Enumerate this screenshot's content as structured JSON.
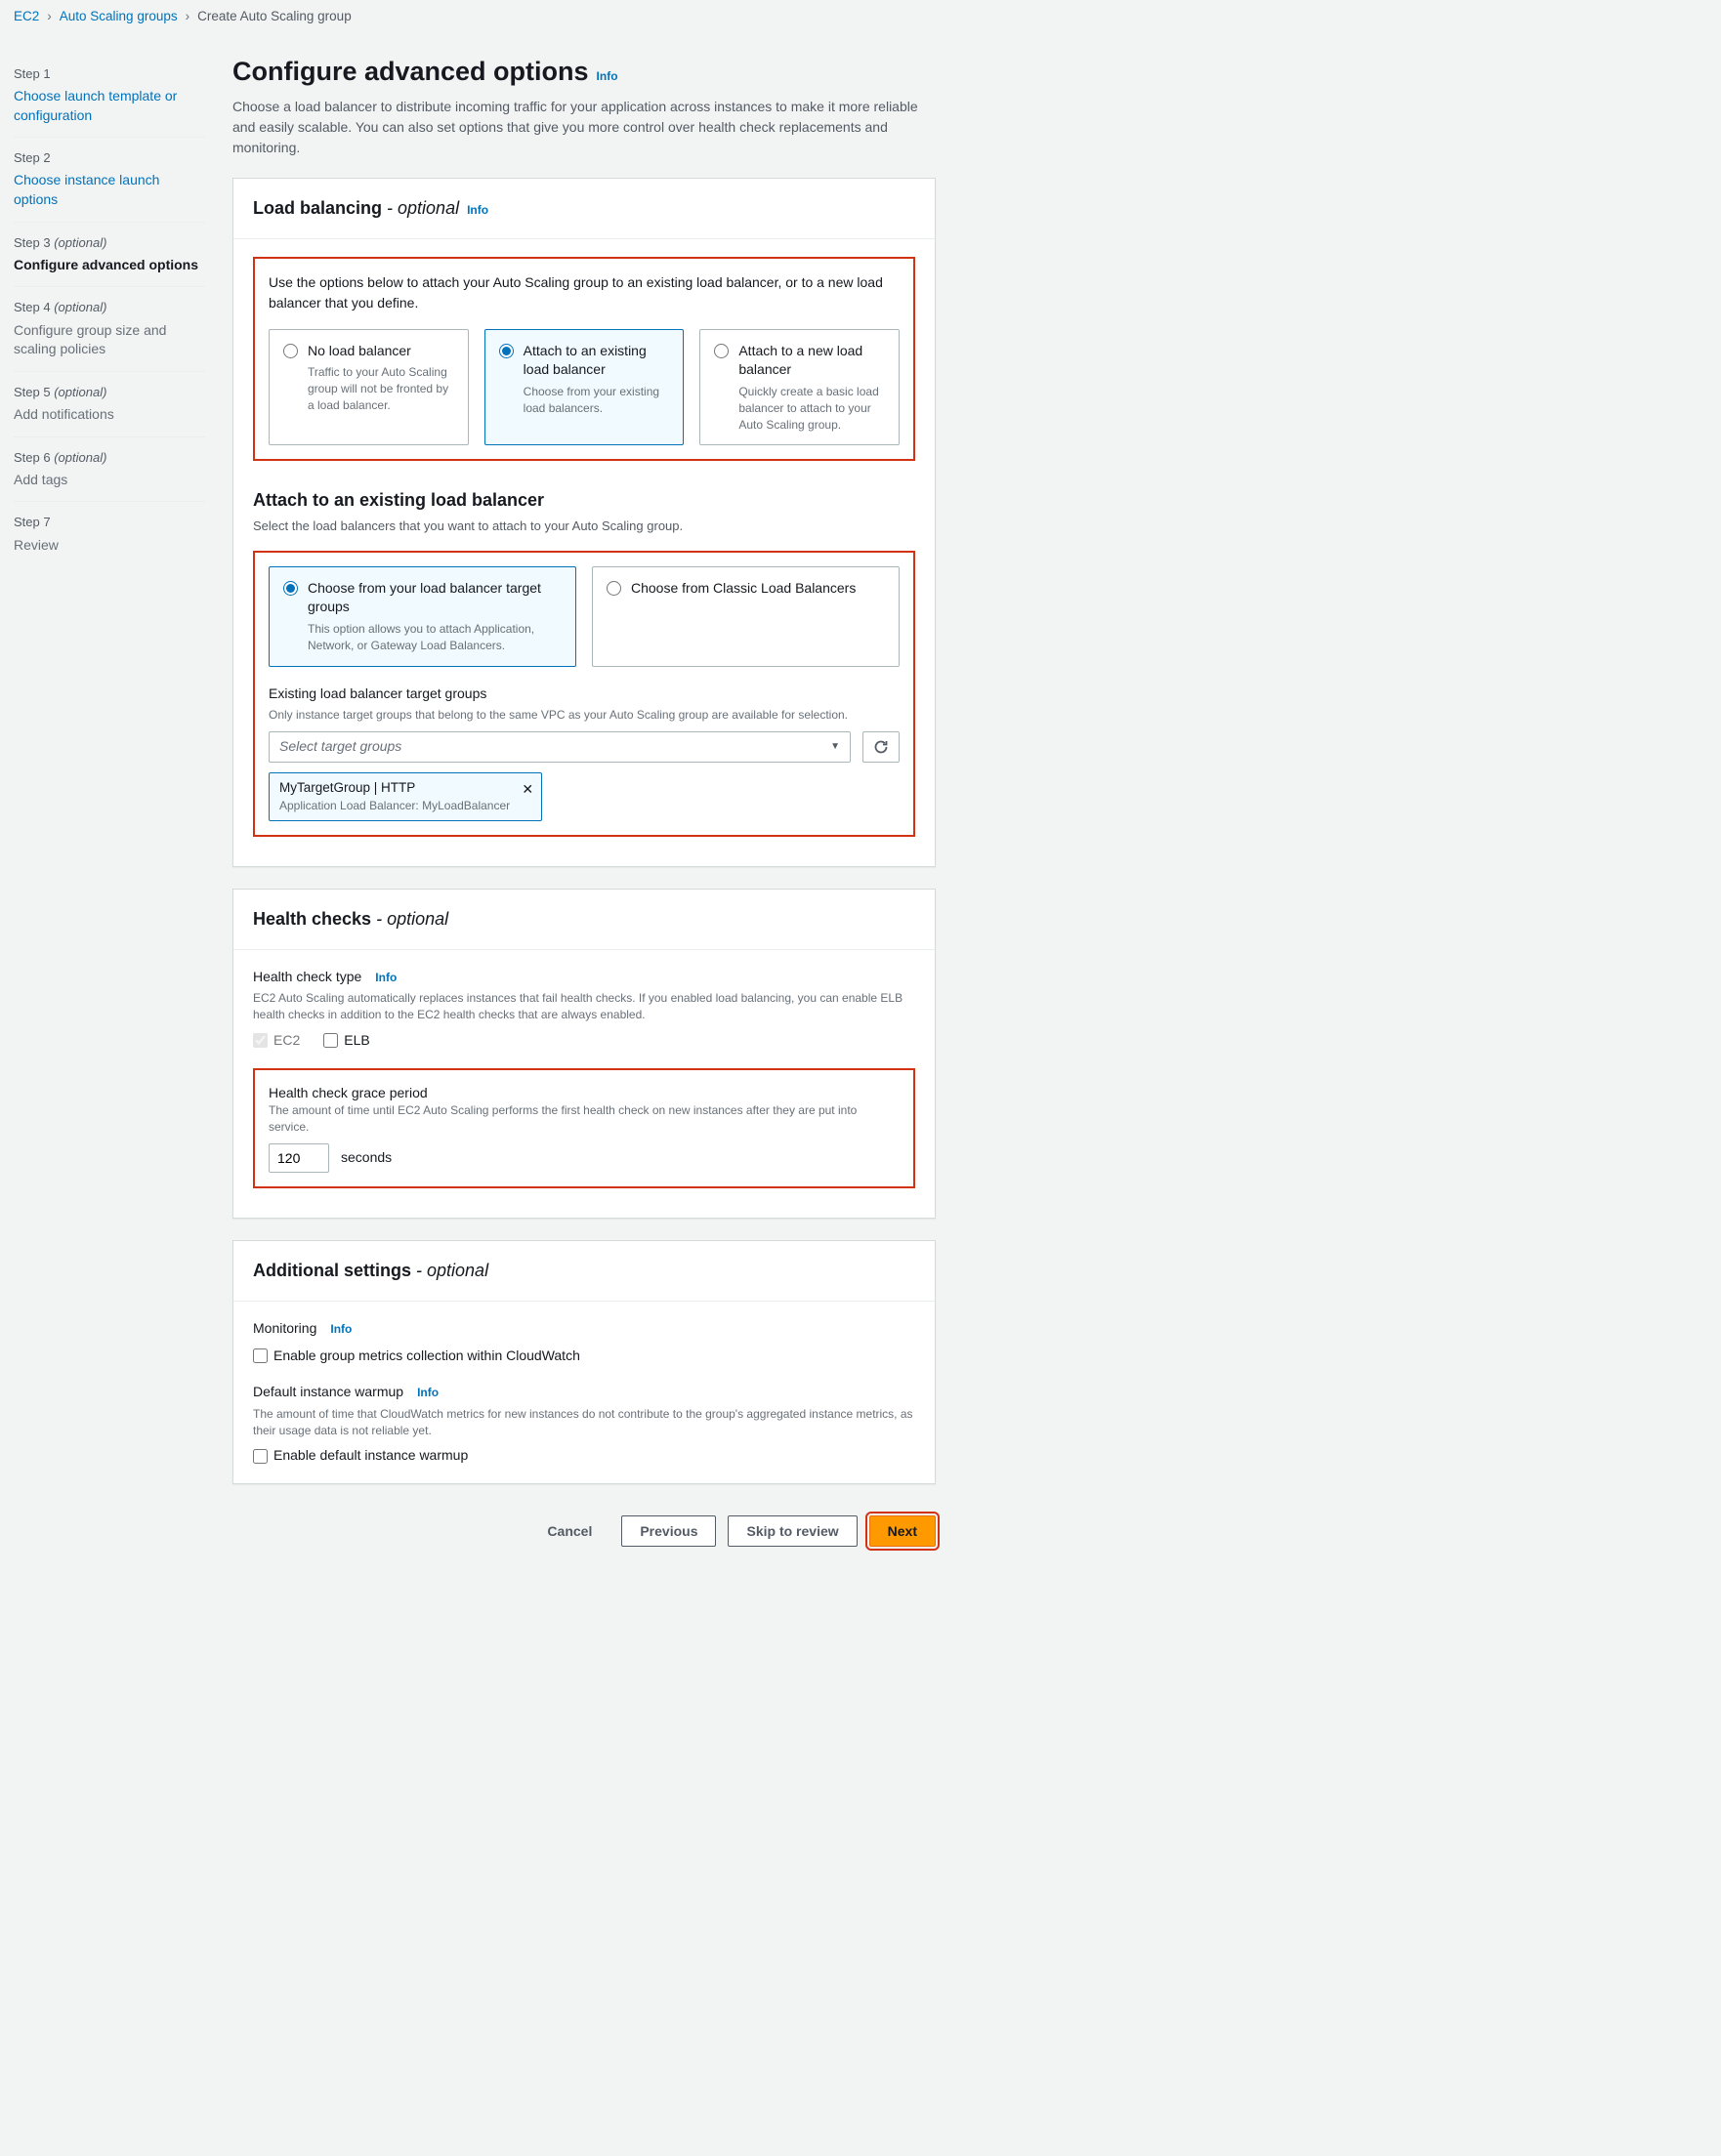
{
  "breadcrumb": {
    "ec2": "EC2",
    "asg": "Auto Scaling groups",
    "current": "Create Auto Scaling group"
  },
  "steps": [
    {
      "label": "Step 1",
      "title": "Choose launch template or configuration",
      "link": true
    },
    {
      "label": "Step 2",
      "title": "Choose instance launch options",
      "link": true
    },
    {
      "label": "Step 3",
      "optional": "(optional)",
      "title": "Configure advanced options",
      "active": true
    },
    {
      "label": "Step 4",
      "optional": "(optional)",
      "title": "Configure group size and scaling policies"
    },
    {
      "label": "Step 5",
      "optional": "(optional)",
      "title": "Add notifications"
    },
    {
      "label": "Step 6",
      "optional": "(optional)",
      "title": "Add tags"
    },
    {
      "label": "Step 7",
      "title": "Review"
    }
  ],
  "page": {
    "title": "Configure advanced options",
    "info": "Info",
    "desc": "Choose a load balancer to distribute incoming traffic for your application across instances to make it more reliable and easily scalable. You can also set options that give you more control over health check replacements and monitoring."
  },
  "lb": {
    "title": "Load balancing",
    "optional": "- optional",
    "info": "Info",
    "desc": "Use the options below to attach your Auto Scaling group to an existing load balancer, or to a new load balancer that you define.",
    "opt1": {
      "title": "No load balancer",
      "desc": "Traffic to your Auto Scaling group will not be fronted by a load balancer."
    },
    "opt2": {
      "title": "Attach to an existing load balancer",
      "desc": "Choose from your existing load balancers."
    },
    "opt3": {
      "title": "Attach to a new load balancer",
      "desc": "Quickly create a basic load balancer to attach to your Auto Scaling group."
    }
  },
  "attach": {
    "title": "Attach to an existing load balancer",
    "desc": "Select the load balancers that you want to attach to your Auto Scaling group.",
    "opt1": {
      "title": "Choose from your load balancer target groups",
      "desc": "This option allows you to attach Application, Network, or Gateway Load Balancers."
    },
    "opt2": {
      "title": "Choose from Classic Load Balancers"
    },
    "tg": {
      "label": "Existing load balancer target groups",
      "hint": "Only instance target groups that belong to the same VPC as your Auto Scaling group are available for selection.",
      "placeholder": "Select target groups"
    },
    "token": {
      "title": "MyTargetGroup | HTTP",
      "sub": "Application Load Balancer: MyLoadBalancer"
    }
  },
  "health": {
    "title": "Health checks",
    "optional": "- optional",
    "type_label": "Health check type",
    "info": "Info",
    "type_hint": "EC2 Auto Scaling automatically replaces instances that fail health checks. If you enabled load balancing, you can enable ELB health checks in addition to the EC2 health checks that are always enabled.",
    "ec2": "EC2",
    "elb": "ELB",
    "grace_label": "Health check grace period",
    "grace_hint": "The amount of time until EC2 Auto Scaling performs the first health check on new instances after they are put into service.",
    "grace_value": "120",
    "seconds": "seconds"
  },
  "additional": {
    "title": "Additional settings",
    "optional": "- optional",
    "monitoring": "Monitoring",
    "info": "Info",
    "metrics": "Enable group metrics collection within CloudWatch",
    "warmup_label": "Default instance warmup",
    "warmup_hint": "The amount of time that CloudWatch metrics for new instances do not contribute to the group's aggregated instance metrics, as their usage data is not reliable yet.",
    "warmup_cb": "Enable default instance warmup"
  },
  "footer": {
    "cancel": "Cancel",
    "previous": "Previous",
    "skip": "Skip to review",
    "next": "Next"
  }
}
